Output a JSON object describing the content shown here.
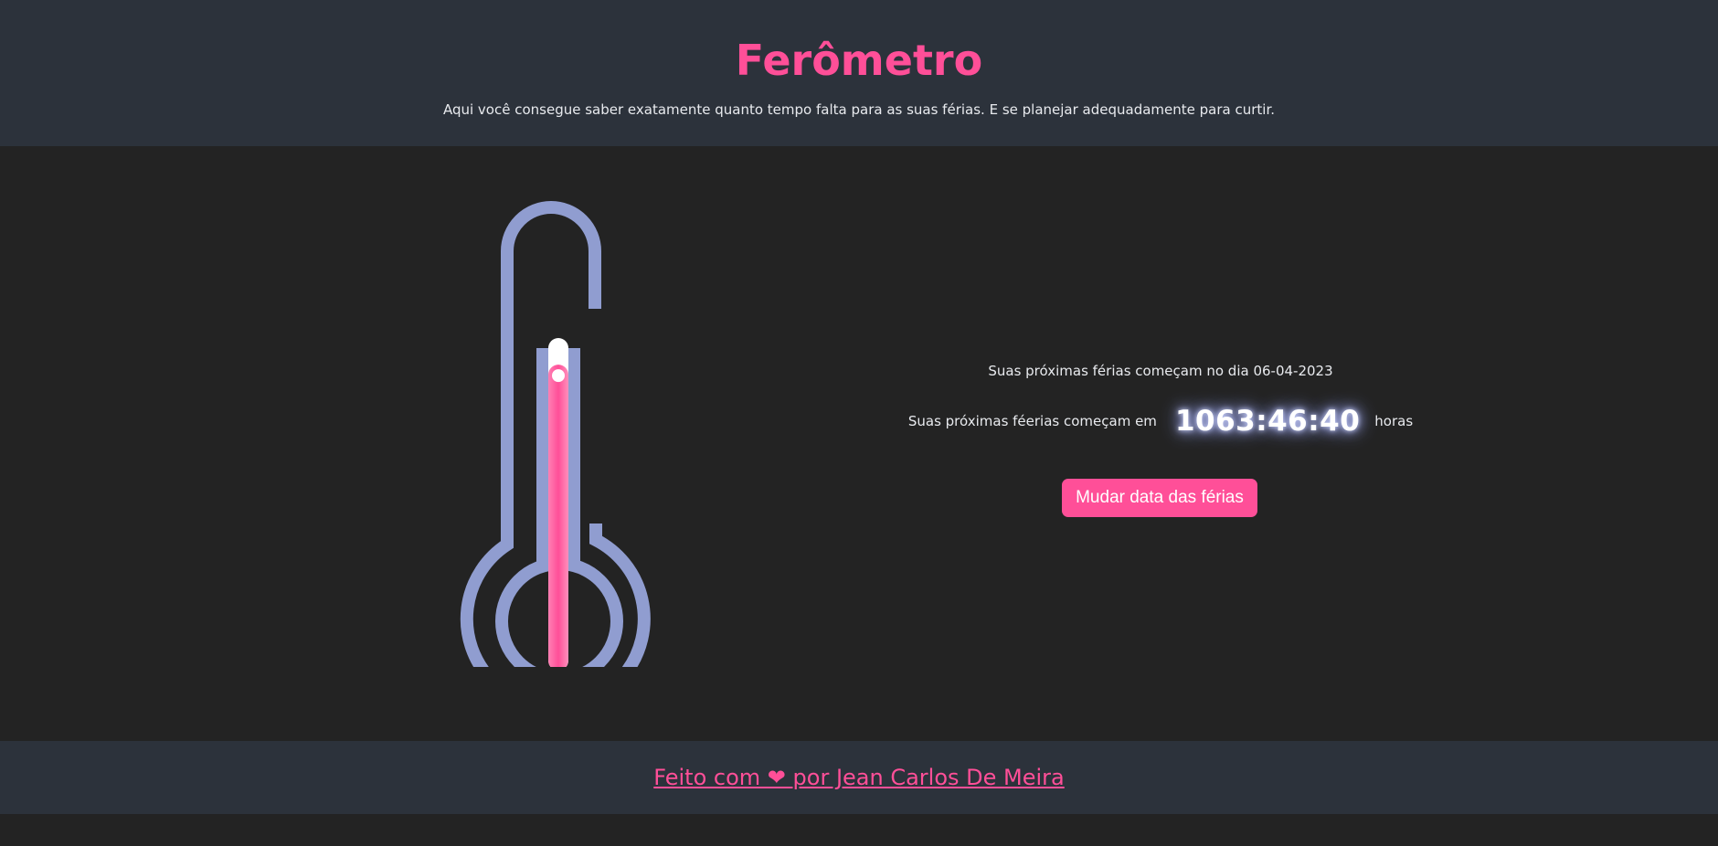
{
  "header": {
    "title": "Ferômetro",
    "subtitle": "Aqui você consegue saber exatamente quanto tempo falta para as suas férias. E se planejar adequadamente para curtir."
  },
  "main": {
    "vacation_date_text": "Suas próximas férias começam no dia 06-04-2023",
    "countdown_prefix": "Suas próximas féerias começam em",
    "countdown_value": "1063:46:40",
    "countdown_suffix": "horas",
    "change_date_button": "Mudar data das férias",
    "thermometer_icon": "thermometer-icon",
    "thermometer_level": 0.92
  },
  "footer": {
    "credit_link": "Feito com ❤ por Jean Carlos De Meira"
  },
  "colors": {
    "accent": "#ff4f98",
    "header_bg": "#2c323b",
    "page_bg": "#232323",
    "thermometer_outline": "#909dd0",
    "mercury": "#ff4f98"
  }
}
